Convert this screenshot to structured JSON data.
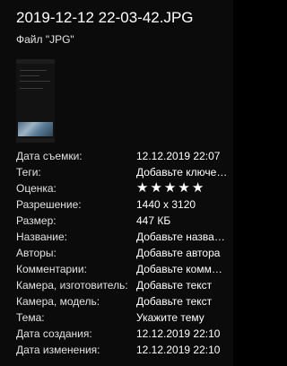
{
  "file": {
    "name": "2019-12-12 22-03-42.JPG",
    "type_label": "Файл \"JPG\""
  },
  "colors": {
    "background": "#0b0b0b",
    "text": "#ffffff",
    "label_text": "#e2e2e2"
  },
  "properties": [
    {
      "label": "Дата съемки:",
      "value": "12.12.2019 22:07"
    },
    {
      "label": "Теги:",
      "value": "Добавьте ключевое слово"
    },
    {
      "label": "Оценка:",
      "value": null,
      "rating": 0,
      "rating_max": 5
    },
    {
      "label": "Разрешение:",
      "value": "1440 x 3120"
    },
    {
      "label": "Размер:",
      "value": "447 КБ"
    },
    {
      "label": "Название:",
      "value": "Добавьте название"
    },
    {
      "label": "Авторы:",
      "value": "Добавьте автора"
    },
    {
      "label": "Комментарии:",
      "value": "Добавьте комментарии"
    },
    {
      "label": "Камера, изготовитель:",
      "value": "Добавьте текст"
    },
    {
      "label": "Камера, модель:",
      "value": "Добавьте текст"
    },
    {
      "label": "Тема:",
      "value": "Укажите тему"
    },
    {
      "label": "Дата создания:",
      "value": "12.12.2019 22:10"
    },
    {
      "label": "Дата изменения:",
      "value": "12.12.2019 22:10"
    }
  ],
  "rating_icon": "star-outline-icon"
}
